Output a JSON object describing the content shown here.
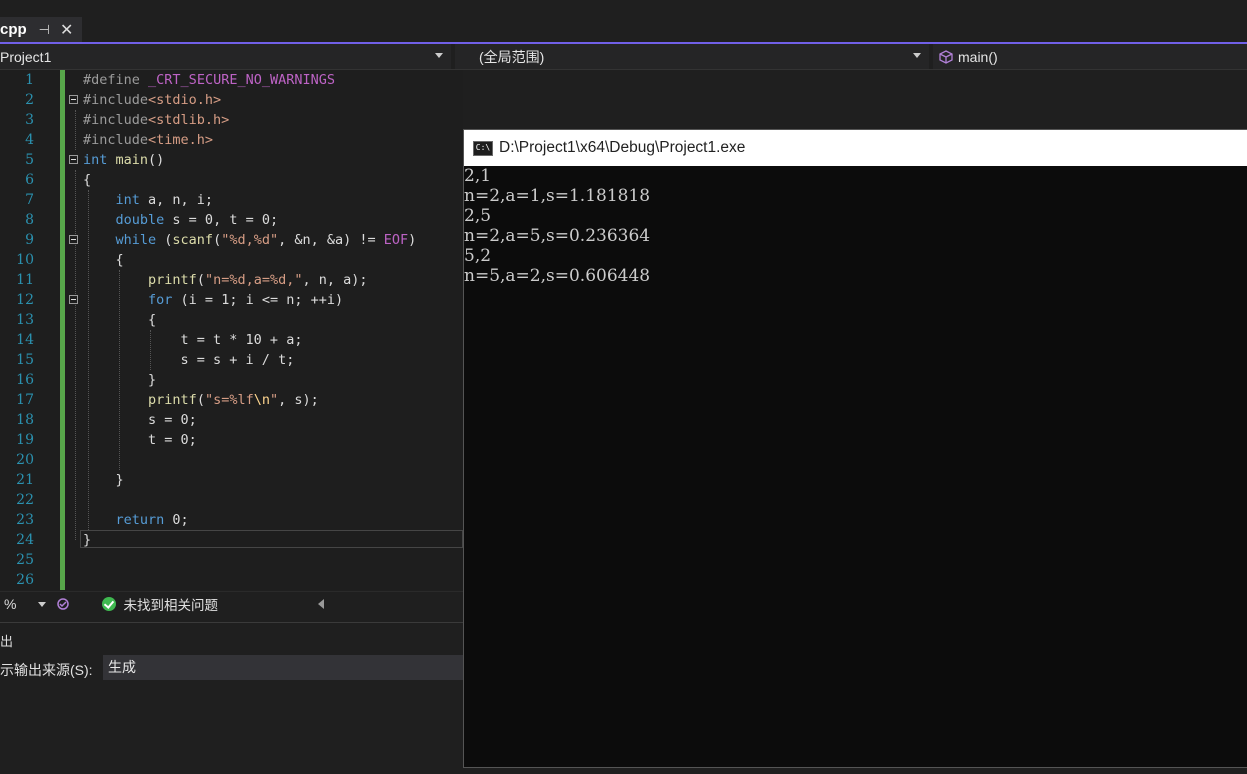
{
  "tab": {
    "label": "cpp",
    "pin_icon": "pin-icon",
    "close_icon": "close-icon"
  },
  "navbar": {
    "project": "Project1",
    "scope": "(全局范围)",
    "member": "main()"
  },
  "editor": {
    "line_numbers": [
      "1",
      "2",
      "3",
      "4",
      "5",
      "6",
      "7",
      "8",
      "9",
      "10",
      "11",
      "12",
      "13",
      "14",
      "15",
      "16",
      "17",
      "18",
      "19",
      "20",
      "21",
      "22",
      "23",
      "24",
      "25",
      "26"
    ],
    "lines": [
      "#define _CRT_SECURE_NO_WARNINGS",
      "#include<stdio.h>",
      "#include<stdlib.h>",
      "#include<time.h>",
      "int main()",
      "{",
      "    int a, n, i;",
      "    double s = 0, t = 0;",
      "    while (scanf(\"%d,%d\", &n, &a) != EOF)",
      "    {",
      "        printf(\"n=%d,a=%d,\", n, a);",
      "        for (i = 1; i <= n; ++i)",
      "        {",
      "            t = t * 10 + a;",
      "            s = s + i / t;",
      "        }",
      "        printf(\"s=%lf\\n\", s);",
      "        s = 0;",
      "        t = 0;",
      "",
      "    }",
      "",
      "    return 0;",
      "}",
      "",
      ""
    ]
  },
  "status": {
    "zoom": "%",
    "message": "未找到相关问题"
  },
  "output": {
    "title": "出",
    "source_label": "示输出来源(S):",
    "source_value": "生成"
  },
  "console": {
    "icon_text": "C:\\",
    "path": "D:\\Project1\\x64\\Debug\\Project1.exe",
    "lines": [
      "2,1",
      "n=2,a=1,s=1.181818",
      "2,5",
      "n=2,a=5,s=0.236364",
      "5,2",
      "n=5,a=2,s=0.606448"
    ]
  }
}
